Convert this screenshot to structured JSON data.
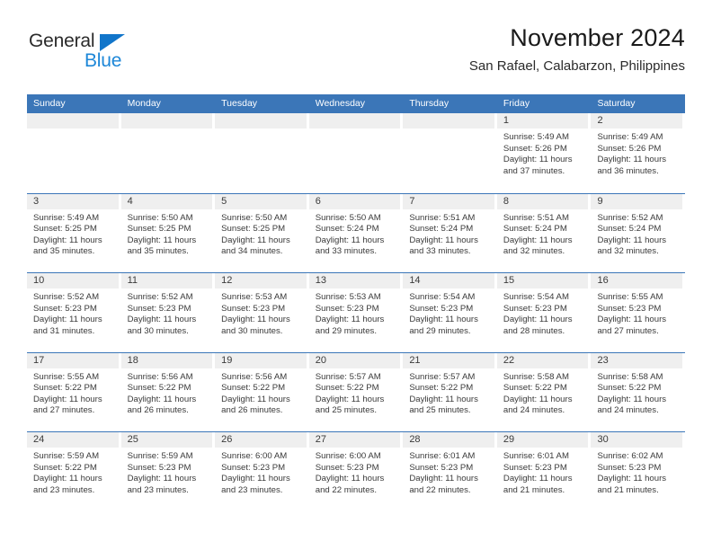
{
  "brand": {
    "name_top": "General",
    "name_bottom": "Blue",
    "triangle_color": "#1175ca",
    "blue_color": "#1d87d8"
  },
  "header": {
    "title": "November 2024",
    "subtitle": "San Rafael, Calabarzon, Philippines"
  },
  "theme": {
    "header_blue": "#3b76b8",
    "daynum_gray": "#efefef",
    "text": "#3a3a3a"
  },
  "weekdays": [
    "Sunday",
    "Monday",
    "Tuesday",
    "Wednesday",
    "Thursday",
    "Friday",
    "Saturday"
  ],
  "labels": {
    "sunrise": "Sunrise:",
    "sunset": "Sunset:",
    "daylight": "Daylight:"
  },
  "weeks": [
    [
      {
        "day": "",
        "empty": true
      },
      {
        "day": "",
        "empty": true
      },
      {
        "day": "",
        "empty": true
      },
      {
        "day": "",
        "empty": true
      },
      {
        "day": "",
        "empty": true
      },
      {
        "day": "1",
        "sunrise": "Sunrise: 5:49 AM",
        "sunset": "Sunset: 5:26 PM",
        "daylight": "Daylight: 11 hours and 37 minutes."
      },
      {
        "day": "2",
        "sunrise": "Sunrise: 5:49 AM",
        "sunset": "Sunset: 5:26 PM",
        "daylight": "Daylight: 11 hours and 36 minutes."
      }
    ],
    [
      {
        "day": "3",
        "sunrise": "Sunrise: 5:49 AM",
        "sunset": "Sunset: 5:25 PM",
        "daylight": "Daylight: 11 hours and 35 minutes."
      },
      {
        "day": "4",
        "sunrise": "Sunrise: 5:50 AM",
        "sunset": "Sunset: 5:25 PM",
        "daylight": "Daylight: 11 hours and 35 minutes."
      },
      {
        "day": "5",
        "sunrise": "Sunrise: 5:50 AM",
        "sunset": "Sunset: 5:25 PM",
        "daylight": "Daylight: 11 hours and 34 minutes."
      },
      {
        "day": "6",
        "sunrise": "Sunrise: 5:50 AM",
        "sunset": "Sunset: 5:24 PM",
        "daylight": "Daylight: 11 hours and 33 minutes."
      },
      {
        "day": "7",
        "sunrise": "Sunrise: 5:51 AM",
        "sunset": "Sunset: 5:24 PM",
        "daylight": "Daylight: 11 hours and 33 minutes."
      },
      {
        "day": "8",
        "sunrise": "Sunrise: 5:51 AM",
        "sunset": "Sunset: 5:24 PM",
        "daylight": "Daylight: 11 hours and 32 minutes."
      },
      {
        "day": "9",
        "sunrise": "Sunrise: 5:52 AM",
        "sunset": "Sunset: 5:24 PM",
        "daylight": "Daylight: 11 hours and 32 minutes."
      }
    ],
    [
      {
        "day": "10",
        "sunrise": "Sunrise: 5:52 AM",
        "sunset": "Sunset: 5:23 PM",
        "daylight": "Daylight: 11 hours and 31 minutes."
      },
      {
        "day": "11",
        "sunrise": "Sunrise: 5:52 AM",
        "sunset": "Sunset: 5:23 PM",
        "daylight": "Daylight: 11 hours and 30 minutes."
      },
      {
        "day": "12",
        "sunrise": "Sunrise: 5:53 AM",
        "sunset": "Sunset: 5:23 PM",
        "daylight": "Daylight: 11 hours and 30 minutes."
      },
      {
        "day": "13",
        "sunrise": "Sunrise: 5:53 AM",
        "sunset": "Sunset: 5:23 PM",
        "daylight": "Daylight: 11 hours and 29 minutes."
      },
      {
        "day": "14",
        "sunrise": "Sunrise: 5:54 AM",
        "sunset": "Sunset: 5:23 PM",
        "daylight": "Daylight: 11 hours and 29 minutes."
      },
      {
        "day": "15",
        "sunrise": "Sunrise: 5:54 AM",
        "sunset": "Sunset: 5:23 PM",
        "daylight": "Daylight: 11 hours and 28 minutes."
      },
      {
        "day": "16",
        "sunrise": "Sunrise: 5:55 AM",
        "sunset": "Sunset: 5:23 PM",
        "daylight": "Daylight: 11 hours and 27 minutes."
      }
    ],
    [
      {
        "day": "17",
        "sunrise": "Sunrise: 5:55 AM",
        "sunset": "Sunset: 5:22 PM",
        "daylight": "Daylight: 11 hours and 27 minutes."
      },
      {
        "day": "18",
        "sunrise": "Sunrise: 5:56 AM",
        "sunset": "Sunset: 5:22 PM",
        "daylight": "Daylight: 11 hours and 26 minutes."
      },
      {
        "day": "19",
        "sunrise": "Sunrise: 5:56 AM",
        "sunset": "Sunset: 5:22 PM",
        "daylight": "Daylight: 11 hours and 26 minutes."
      },
      {
        "day": "20",
        "sunrise": "Sunrise: 5:57 AM",
        "sunset": "Sunset: 5:22 PM",
        "daylight": "Daylight: 11 hours and 25 minutes."
      },
      {
        "day": "21",
        "sunrise": "Sunrise: 5:57 AM",
        "sunset": "Sunset: 5:22 PM",
        "daylight": "Daylight: 11 hours and 25 minutes."
      },
      {
        "day": "22",
        "sunrise": "Sunrise: 5:58 AM",
        "sunset": "Sunset: 5:22 PM",
        "daylight": "Daylight: 11 hours and 24 minutes."
      },
      {
        "day": "23",
        "sunrise": "Sunrise: 5:58 AM",
        "sunset": "Sunset: 5:22 PM",
        "daylight": "Daylight: 11 hours and 24 minutes."
      }
    ],
    [
      {
        "day": "24",
        "sunrise": "Sunrise: 5:59 AM",
        "sunset": "Sunset: 5:22 PM",
        "daylight": "Daylight: 11 hours and 23 minutes."
      },
      {
        "day": "25",
        "sunrise": "Sunrise: 5:59 AM",
        "sunset": "Sunset: 5:23 PM",
        "daylight": "Daylight: 11 hours and 23 minutes."
      },
      {
        "day": "26",
        "sunrise": "Sunrise: 6:00 AM",
        "sunset": "Sunset: 5:23 PM",
        "daylight": "Daylight: 11 hours and 23 minutes."
      },
      {
        "day": "27",
        "sunrise": "Sunrise: 6:00 AM",
        "sunset": "Sunset: 5:23 PM",
        "daylight": "Daylight: 11 hours and 22 minutes."
      },
      {
        "day": "28",
        "sunrise": "Sunrise: 6:01 AM",
        "sunset": "Sunset: 5:23 PM",
        "daylight": "Daylight: 11 hours and 22 minutes."
      },
      {
        "day": "29",
        "sunrise": "Sunrise: 6:01 AM",
        "sunset": "Sunset: 5:23 PM",
        "daylight": "Daylight: 11 hours and 21 minutes."
      },
      {
        "day": "30",
        "sunrise": "Sunrise: 6:02 AM",
        "sunset": "Sunset: 5:23 PM",
        "daylight": "Daylight: 11 hours and 21 minutes."
      }
    ]
  ]
}
